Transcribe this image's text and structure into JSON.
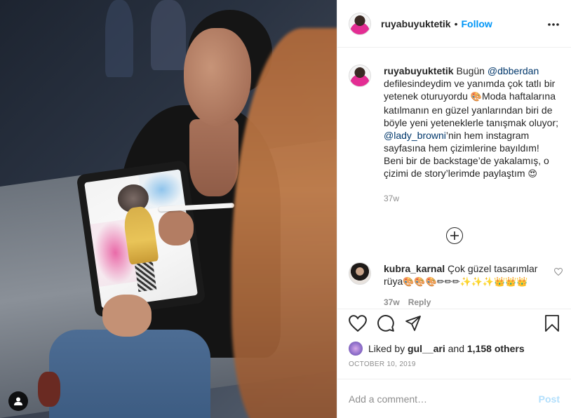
{
  "post": {
    "username": "ruyabuyuktetik",
    "follow_label": "Follow",
    "separator": "•",
    "more_label": "•••",
    "caption": {
      "username": "ruyabuyuktetik",
      "part1": " Bugün ",
      "mention1": "@dbberdan",
      "part2": " defilesindeydim ve yanımda çok tatlı bir yetenek oturuyordu ",
      "emoji1": "🎨",
      "part3": "Moda haftalarına katılmanın en güzel yanlarından biri de böyle yeni yeteneklerle tanışmak oluyor; ",
      "mention2": "@lady_browni",
      "part4": "’nin hem instagram sayfasına hem çizimlerine bayıldım! Beni bir de backstage’de yakalamış, o çizimi de story’lerimde paylaştım ",
      "emoji2": "😍",
      "time": "37w"
    },
    "load_more_label": "+",
    "comments": [
      {
        "username": "kubra_karnal",
        "text": " Çok güzel tasarımlar rüya",
        "emojis": "🎨🎨🎨✏✏✏✨✨✨👑👑👑",
        "time": "37w",
        "reply_label": "Reply"
      }
    ],
    "likes": {
      "prefix": "Liked by ",
      "user": "gul__ari",
      "middle": " and ",
      "count": "1,158 others"
    },
    "date": "OCTOBER 10, 2019",
    "add_comment_placeholder": "Add a comment…",
    "post_label": "Post"
  }
}
